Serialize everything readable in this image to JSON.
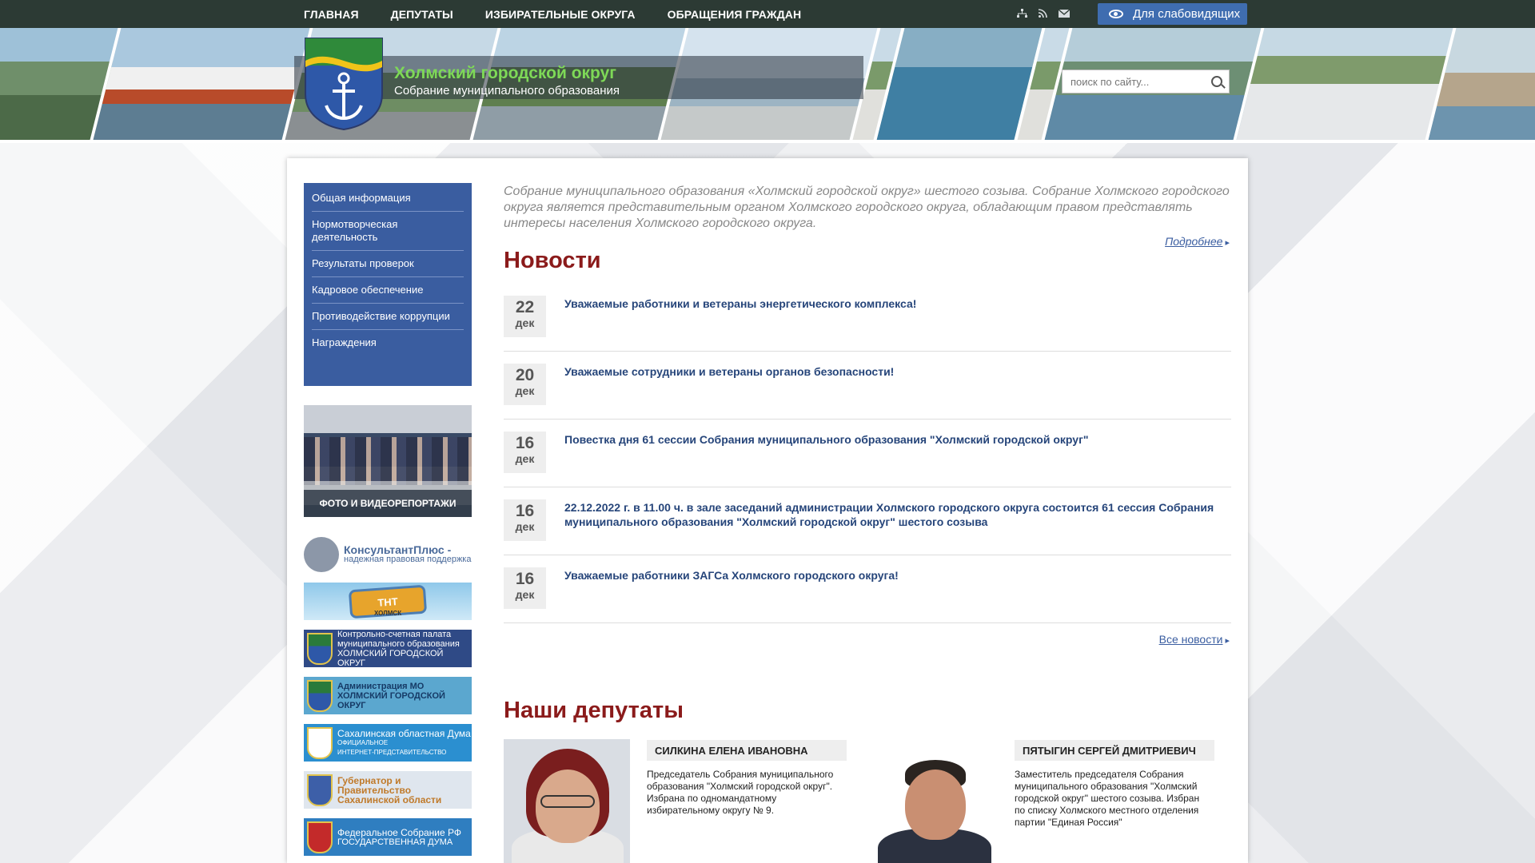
{
  "topnav": {
    "items": [
      "ГЛАВНАЯ",
      "ДЕПУТАТЫ",
      "ИЗБИРАТЕЛЬНЫЕ ОКРУГА",
      "ОБРАЩЕНИЯ ГРАЖДАН"
    ],
    "icons": [
      "sitemap-icon",
      "rss-icon",
      "mail-icon"
    ],
    "vision_label": "Для слабовидящих"
  },
  "header": {
    "title": "Холмский городской округ",
    "subtitle": "Собрание муниципального образования",
    "search_placeholder": "поиск по сайту..."
  },
  "sidebar": {
    "menu": [
      "Общая информация",
      "Нормотворческая деятельность",
      "Результаты проверок",
      "Кадровое обеспечение",
      "Противодействие коррупции",
      "Награждения"
    ],
    "photo_caption": "ФОТО И ВИДЕОРЕПОРТАЖИ",
    "links": {
      "consult_title": "КонсультантПлюс -",
      "consult_sub": "надежная правовая поддержка",
      "tnt": "ТНТ",
      "tnt_sub": "ХОЛМСК",
      "ksp_1": "Контрольно-счетная палата",
      "ksp_2": "муниципального образования",
      "ksp_3": "ХОЛМСКИЙ ГОРОДСКОЙ ОКРУГ",
      "admin_1": "Администрация МО",
      "admin_2": "ХОЛМСКИЙ ГОРОДСКОЙ",
      "admin_3": "ОКРУГ",
      "duma_1": "Сахалинская областная Дума",
      "duma_2": "ОФИЦИАЛЬНОЕ",
      "duma_3": "ИНТЕРНЕТ-ПРЕДСТАВИТЕЛЬСТВО",
      "gov_1": "Губернатор и Правительство",
      "gov_2": "Сахалинской области",
      "fed_1": "Федеральное Собрание РФ",
      "fed_2": "ГОСУДАРСТВЕННАЯ ДУМА"
    }
  },
  "main": {
    "intro": "Собрание муниципального образования «Холмский городской округ» шестого созыва. Собрание Холмского городского округа является представительным органом Холмского городского округа, обладающим правом представлять интересы населения Холмского городского округа.",
    "more_label": "Подробнее",
    "news_heading": "Новости",
    "news": [
      {
        "day": "22",
        "month": "дек",
        "title": "Уважаемые работники и ветераны энергетического комплекса!"
      },
      {
        "day": "20",
        "month": "дек",
        "title": "Уважаемые сотрудники и ветераны органов безопасности!"
      },
      {
        "day": "16",
        "month": "дек",
        "title": "Повестка дня 61 сессии Собрания муниципального образования \"Холмский городской округ\""
      },
      {
        "day": "16",
        "month": "дек",
        "title": "22.12.2022 г. в 11.00 ч. в зале заседаний администрации Холмского городского округа состоится 61 сессия Собрания муниципального образования \"Холмский городской округ\" шестого созыва"
      },
      {
        "day": "16",
        "month": "дек",
        "title": "Уважаемые работники ЗАГСа Холмского городского округа!"
      }
    ],
    "all_news_label": "Все новости",
    "deputies_heading": "Наши депутаты",
    "deputies": [
      {
        "name": "СИЛКИНА ЕЛЕНА ИВАНОВНА",
        "desc": "Председатель Собрания муниципального образования \"Холмский городской округ\".  Избрана по одномандатному избирательному округу № 9."
      },
      {
        "name": "ПЯТЫГИН СЕРГЕЙ ДМИТРИЕВИЧ",
        "desc": "Заместитель председателя  Собрания муниципального образования \"Холмский городской округ\" шестого созыва. Избран по списку Холмского местного отделения партии \"Единая Россия\""
      }
    ]
  },
  "colors": {
    "topbar": "#2c3a34",
    "accent_blue": "#3a5da0",
    "heading_red": "#8b1b1b",
    "brand_green": "#7ed957"
  }
}
